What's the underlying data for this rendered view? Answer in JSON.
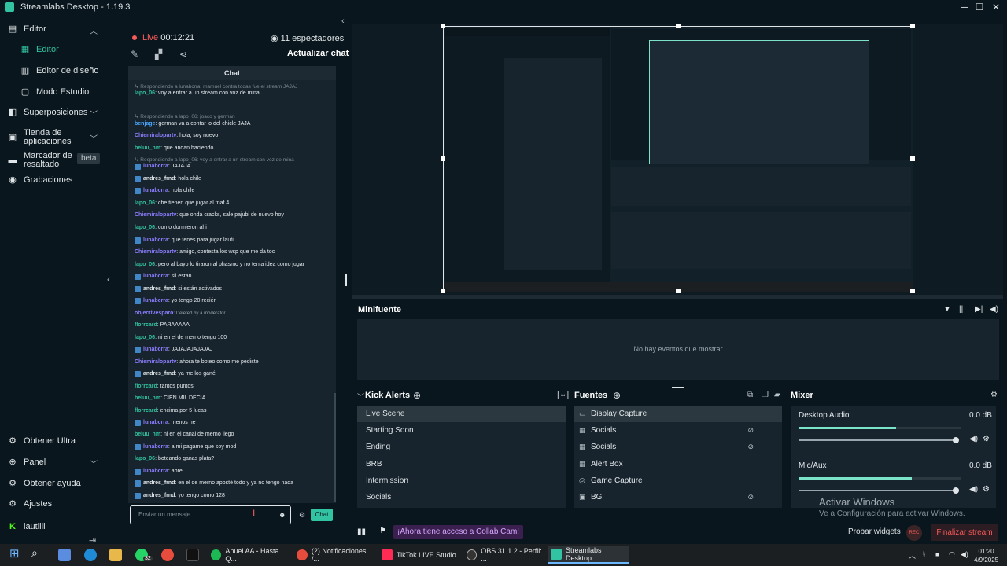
{
  "window": {
    "title": "Streamlabs Desktop - 1.19.3"
  },
  "nav": {
    "items": [
      {
        "label": "Editor"
      },
      {
        "label": "Editor"
      },
      {
        "label": "Editor de diseño"
      },
      {
        "label": "Modo Estudio"
      },
      {
        "label": "Superposiciones"
      },
      {
        "label": "Tienda de aplicaciones"
      },
      {
        "label": "Marcador de resaltado"
      },
      {
        "label": "Grabaciones"
      }
    ],
    "beta": "beta",
    "bottom": [
      {
        "label": "Obtener Ultra"
      },
      {
        "label": "Panel"
      },
      {
        "label": "Obtener ayuda"
      },
      {
        "label": "Ajustes"
      },
      {
        "label": "lautiiii"
      }
    ]
  },
  "live": {
    "label": "Live",
    "time": "00:12:21",
    "viewers": "11 espectadores",
    "refresh": "Actualizar chat"
  },
  "chat": {
    "header": "Chat",
    "messages": [
      {
        "reply": "Respondiendo a lunabcrra: mamuel contra todas fue el stream JAJAJ"
      },
      {
        "user": "lapo_06",
        "text": ": voy a entrar a un stream con voz de mina"
      },
      {
        "reply": "Respondiendo a lapo_06: joaco y german"
      },
      {
        "user": "benjage",
        "text": ": german va a contar lo del chicle JAJA"
      },
      {
        "user": "Chiemiralopartv",
        "text": ": hola, soy nuevo"
      },
      {
        "user": "beluu_hm",
        "text": ": que andan haciendo"
      },
      {
        "reply": "Respondiendo a lapo_06: voy a entrar a un stream con voz de mina"
      },
      {
        "user": "lunabcrra",
        "text": ": JAJAJA"
      },
      {
        "user": "andres_frnd",
        "text": ": hola chile"
      },
      {
        "user": "lunabcrra",
        "text": ": hola chile"
      },
      {
        "user": "lapo_06",
        "text": ": che tienen que jugar al fnaf 4"
      },
      {
        "user": "Chiemiralopartv",
        "text": ": que onda cracks, sale pajubi de nuevo hoy"
      },
      {
        "user": "lapo_06",
        "text": ": como durmieron ahi"
      },
      {
        "user": "lunabcrra",
        "text": ": que tenes para jugar lauti"
      },
      {
        "user": "Chiemiralopartv",
        "text": ": amigo, contesta los wsp que me da toc"
      },
      {
        "user": "lapo_06",
        "text": ": pero al bayo lo tiraron al phasmo y no tenia idea como jugar"
      },
      {
        "user": "lunabcrra",
        "text": ": sii estan"
      },
      {
        "user": "andres_frnd",
        "text": ": si están activados"
      },
      {
        "user": "lunabcrra",
        "text": ": yo tengo 20 recién"
      },
      {
        "user": "objectivesparo",
        "text": ": Deleted by a moderator"
      },
      {
        "user": "florrcard",
        "text": ": PARAAAAA"
      },
      {
        "user": "lapo_06",
        "text": ": ni en el de merno tengo 100"
      },
      {
        "user": "lunabcrra",
        "text": ": JAJAJAJAJAJAJ"
      },
      {
        "user": "Chiemiralopartv",
        "text": ": ahora te boteo como me pediste"
      },
      {
        "user": "andres_frnd",
        "text": ": ya me los gané"
      },
      {
        "user": "florrcard",
        "text": ": tantos puntos"
      },
      {
        "user": "beluu_hm",
        "text": ": CIEN MIL DECIA"
      },
      {
        "user": "florrcard",
        "text": ": encima por 5 lucas"
      },
      {
        "user": "lunabcrra",
        "text": ": menos ne"
      },
      {
        "user": "beluu_hm",
        "text": ": ni en el canal de merno llego"
      },
      {
        "user": "lunabcrra",
        "text": ": a mi pagame que soy mod"
      },
      {
        "user": "lapo_06",
        "text": ": boteando ganas plata?"
      },
      {
        "user": "lunabcrra",
        "text": ": ahre"
      },
      {
        "user": "andres_frnd",
        "text": ": en el de merno aposté todo y ya no tengo nada"
      },
      {
        "user": "andres_frnd",
        "text": ": yo tengo como 128"
      }
    ],
    "input_placeholder": "Enviar un mensaje",
    "send_label": "Chat"
  },
  "minifuente": {
    "title": "Minifuente",
    "empty": "No hay eventos que mostrar"
  },
  "scenes": {
    "title": "Kick Alerts",
    "items": [
      "Live Scene",
      "Starting Soon",
      "Ending",
      "BRB",
      "Intermission",
      "Socials"
    ]
  },
  "sources": {
    "title": "Fuentes",
    "items": [
      "Display Capture",
      "Socials",
      "Socials",
      "Alert Box",
      "Game Capture",
      "BG"
    ]
  },
  "mixer": {
    "title": "Mixer",
    "channels": [
      {
        "name": "Desktop Audio",
        "db": "0.0 dB",
        "level": 0.6
      },
      {
        "name": "Mic/Aux",
        "db": "0.0 dB",
        "level": 0.7
      }
    ]
  },
  "bottom": {
    "collab": "¡Ahora tiene acceso a Collab Cam!",
    "probar": "Probar widgets",
    "rec": "REC",
    "end": "Finalizar stream",
    "activate_title": "Activar Windows",
    "activate_sub": "Ve a Configuración para activar Windows."
  },
  "taskbar": {
    "apps": [
      "Anuel AA - Hasta Q...",
      "(2) Notificaciones /...",
      "TikTok LIVE Studio",
      "OBS 31.1.2 - Perfil: ...",
      "Streamlabs Desktop"
    ],
    "badge": "32",
    "time": "01:20",
    "date": "4/9/2025"
  },
  "colors": {
    "accent": "#31c3a2",
    "live": "#f85959",
    "bg": "#09161d",
    "panel": "#17242d"
  }
}
